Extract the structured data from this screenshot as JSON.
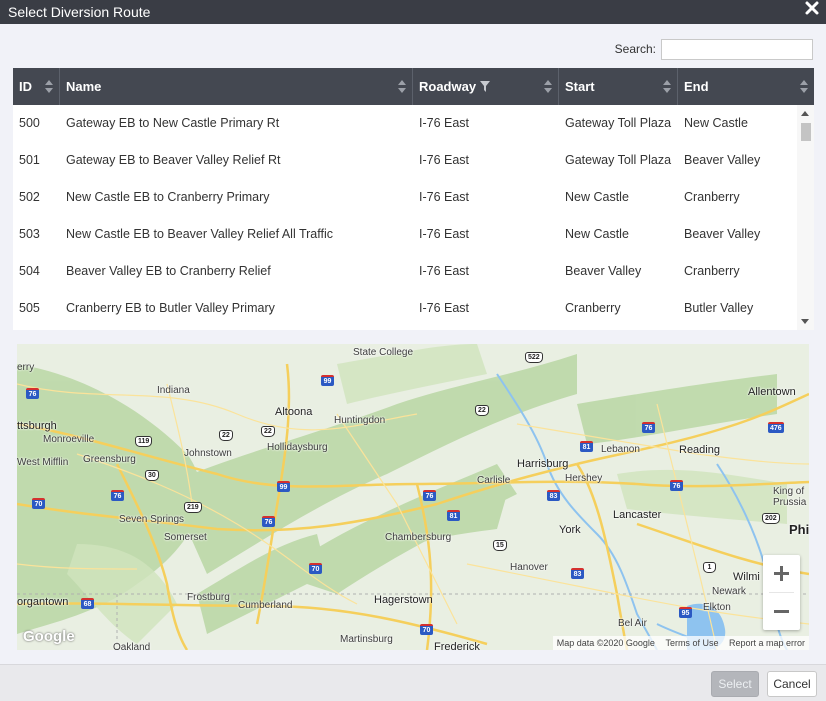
{
  "dialog": {
    "title": "Select Diversion Route"
  },
  "search": {
    "label": "Search:",
    "value": "",
    "placeholder": ""
  },
  "table": {
    "columns": [
      {
        "label": "ID"
      },
      {
        "label": "Name"
      },
      {
        "label": "Roadway"
      },
      {
        "label": "Start"
      },
      {
        "label": "End"
      }
    ],
    "rows": [
      {
        "id": "500",
        "name": "Gateway EB to New Castle Primary Rt",
        "roadway": "I-76 East",
        "start": "Gateway Toll Plaza",
        "end": "New Castle"
      },
      {
        "id": "501",
        "name": "Gateway EB to Beaver Valley Relief Rt",
        "roadway": "I-76 East",
        "start": "Gateway Toll Plaza",
        "end": "Beaver Valley"
      },
      {
        "id": "502",
        "name": "New Castle EB to Cranberry Primary",
        "roadway": "I-76 East",
        "start": "New Castle",
        "end": "Cranberry"
      },
      {
        "id": "503",
        "name": "New Castle EB to Beaver Valley Relief All Traffic",
        "roadway": "I-76 East",
        "start": "New Castle",
        "end": "Beaver Valley"
      },
      {
        "id": "504",
        "name": "Beaver Valley EB to Cranberry Relief",
        "roadway": "I-76 East",
        "start": "Beaver Valley",
        "end": "Cranberry"
      },
      {
        "id": "505",
        "name": "Cranberry EB to Butler Valley Primary",
        "roadway": "I-76 East",
        "start": "Cranberry",
        "end": "Butler Valley"
      }
    ]
  },
  "map": {
    "places": [
      {
        "name": "State College"
      },
      {
        "name": "erry"
      },
      {
        "name": "Indiana"
      },
      {
        "name": "Altoona"
      },
      {
        "name": "Huntingdon"
      },
      {
        "name": "Allentown"
      },
      {
        "name": "ttsburgh"
      },
      {
        "name": "Monroeville"
      },
      {
        "name": "Hollidaysburg"
      },
      {
        "name": "Lebanon"
      },
      {
        "name": "Reading"
      },
      {
        "name": "Johnstown"
      },
      {
        "name": "West Mifflin"
      },
      {
        "name": "Greensburg"
      },
      {
        "name": "Harrisburg"
      },
      {
        "name": "Hershey"
      },
      {
        "name": "Carlisle"
      },
      {
        "name": "King of Prussia"
      },
      {
        "name": "Seven Springs"
      },
      {
        "name": "Somerset"
      },
      {
        "name": "Lancaster"
      },
      {
        "name": "Chambersburg"
      },
      {
        "name": "York"
      },
      {
        "name": "Phil"
      },
      {
        "name": "Hanover"
      },
      {
        "name": "Wilmi"
      },
      {
        "name": "Newark"
      },
      {
        "name": "Frostburg"
      },
      {
        "name": "Cumberland"
      },
      {
        "name": "Hagerstown"
      },
      {
        "name": "Elkton"
      },
      {
        "name": "organtown"
      },
      {
        "name": "Bel Air"
      },
      {
        "name": "Martinsburg"
      },
      {
        "name": "Frederick"
      },
      {
        "name": "Oakland"
      }
    ],
    "shields": [
      {
        "label": "522"
      },
      {
        "label": "99"
      },
      {
        "label": "76"
      },
      {
        "label": "22"
      },
      {
        "label": "22"
      },
      {
        "label": "22"
      },
      {
        "label": "119"
      },
      {
        "label": "81"
      },
      {
        "label": "76"
      },
      {
        "label": "476"
      },
      {
        "label": "30"
      },
      {
        "label": "99"
      },
      {
        "label": "76"
      },
      {
        "label": "83"
      },
      {
        "label": "76"
      },
      {
        "label": "70"
      },
      {
        "label": "76"
      },
      {
        "label": "219"
      },
      {
        "label": "81"
      },
      {
        "label": "76"
      },
      {
        "label": "202"
      },
      {
        "label": "15"
      },
      {
        "label": "70"
      },
      {
        "label": "83"
      },
      {
        "label": "1"
      },
      {
        "label": "68"
      },
      {
        "label": "95"
      },
      {
        "label": "70"
      }
    ],
    "brand": "Google",
    "attribution": {
      "data": "Map data ©2020 Google",
      "terms": "Terms of Use",
      "report": "Report a map error"
    }
  },
  "footer": {
    "select_label": "Select",
    "cancel_label": "Cancel"
  },
  "colors": {
    "titlebar": "#3a3d45",
    "header": "#444851",
    "map_water": "#8ec3ef",
    "map_road": "#f7d468",
    "map_forest": "#b8d6a4"
  }
}
